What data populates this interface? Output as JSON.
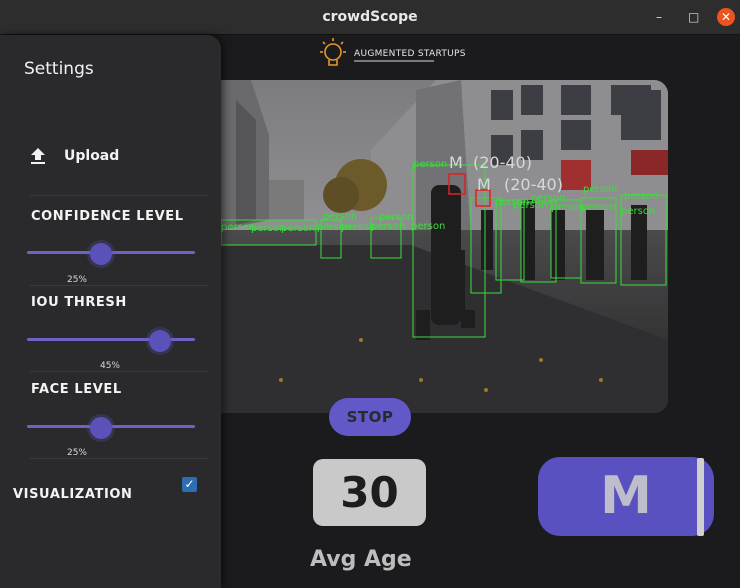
{
  "window": {
    "title": "crowdScope",
    "minimize": "–",
    "maximize": "□",
    "close": "✕"
  },
  "sidebar": {
    "title": "Settings",
    "upload_label": "Upload",
    "confidence": {
      "label": "CONFIDENCE LEVEL",
      "value": 25,
      "value_text": "25%"
    },
    "iou": {
      "label": "IOU THRESH",
      "value": 45,
      "value_text": "45%"
    },
    "face": {
      "label": "FACE LEVEL",
      "value": 25,
      "value_text": "25%"
    },
    "visualization": {
      "label": "VISUALIZATION",
      "checked": true,
      "check_glyph": "✓"
    }
  },
  "logo": {
    "text": "AUGMENTED STARTUPS",
    "icon": "lightbulb-icon"
  },
  "video": {
    "labels": [
      "person",
      "M",
      "(20-40)",
      "M",
      "(20-40)",
      "person",
      "person",
      "person",
      "person",
      "person",
      "person",
      "person",
      "person",
      "person",
      "person",
      "person",
      "person",
      "person",
      "person",
      "person",
      "person",
      "person"
    ]
  },
  "controls": {
    "stop_label": "STOP"
  },
  "stats": {
    "age_value": "30",
    "age_label": "Avg Age",
    "gender_value": "M"
  },
  "colors": {
    "accent": "#5a51c0",
    "detect_green": "#3ddc3d",
    "face_red": "#e02020"
  }
}
